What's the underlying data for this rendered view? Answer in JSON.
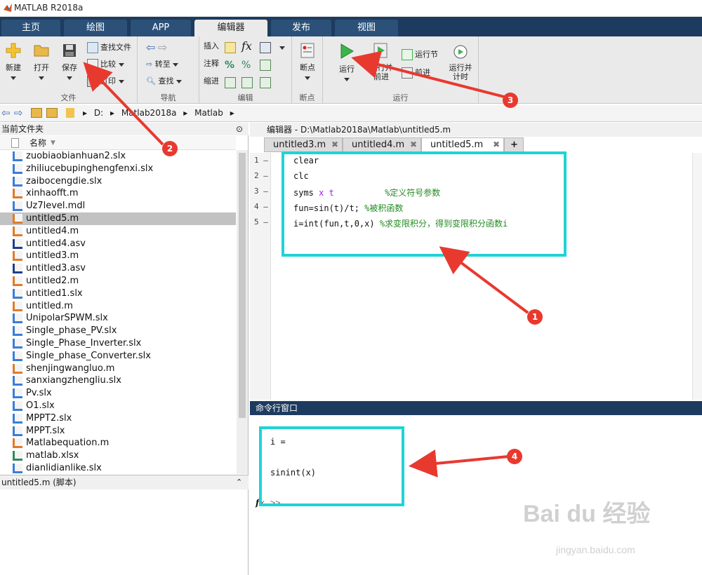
{
  "app": {
    "title": "MATLAB R2018a"
  },
  "tabs": [
    "主页",
    "绘图",
    "APP",
    "编辑器",
    "发布",
    "视图"
  ],
  "ribbon": {
    "file_group": {
      "label": "文件",
      "new": "新建",
      "open": "打开",
      "save": "保存",
      "find_files": "查找文件",
      "compare": "比较",
      "print": "打印"
    },
    "nav_group": {
      "label": "导航",
      "goto": "转至",
      "find": "查找"
    },
    "edit_group": {
      "label": "编辑",
      "insert": "插入",
      "comment": "注释",
      "indent": "缩进"
    },
    "breakpoints_group": {
      "label": "断点",
      "breakpoints": "断点"
    },
    "run_group": {
      "label": "运行",
      "run": "运行",
      "run_advance": "运行并前进",
      "run_section": "运行节",
      "advance": "前进",
      "run_time": "运行并计时"
    }
  },
  "address": {
    "segments": [
      "D:",
      "Matlab2018a",
      "Matlab"
    ]
  },
  "file_browser": {
    "title": "当前文件夹",
    "column": "名称",
    "files": [
      {
        "name": "zuobiaobianhuan2.slx",
        "kind": "slx"
      },
      {
        "name": "zhiliucebupinghengfenxi.slx",
        "kind": "slx"
      },
      {
        "name": "zaibocengdie.slx",
        "kind": "slx"
      },
      {
        "name": "xinhaofft.m",
        "kind": "m"
      },
      {
        "name": "Uz7level.mdl",
        "kind": "mdl"
      },
      {
        "name": "untitled5.m",
        "kind": "m"
      },
      {
        "name": "untitled4.m",
        "kind": "m"
      },
      {
        "name": "untitled4.asv",
        "kind": "asv"
      },
      {
        "name": "untitled3.m",
        "kind": "m"
      },
      {
        "name": "untitled3.asv",
        "kind": "asv"
      },
      {
        "name": "untitled2.m",
        "kind": "m"
      },
      {
        "name": "untitled1.slx",
        "kind": "slx"
      },
      {
        "name": "untitled.m",
        "kind": "m"
      },
      {
        "name": "UnipolarSPWM.slx",
        "kind": "slx"
      },
      {
        "name": "Single_phase_PV.slx",
        "kind": "slx"
      },
      {
        "name": "Single_Phase_Inverter.slx",
        "kind": "slx"
      },
      {
        "name": "Single_phase_Converter.slx",
        "kind": "slx"
      },
      {
        "name": "shenjingwangluo.m",
        "kind": "m"
      },
      {
        "name": "sanxiangzhengliu.slx",
        "kind": "slx"
      },
      {
        "name": "Pv.slx",
        "kind": "slx"
      },
      {
        "name": "O1.slx",
        "kind": "slx"
      },
      {
        "name": "MPPT2.slx",
        "kind": "slx"
      },
      {
        "name": "MPPT.slx",
        "kind": "slx"
      },
      {
        "name": "Matlabequation.m",
        "kind": "m"
      },
      {
        "name": "matlab.xlsx",
        "kind": "xlsx"
      },
      {
        "name": "dianlidianlike.slx",
        "kind": "slx"
      }
    ],
    "selected": "untitled5.m"
  },
  "details": {
    "title": "untitled5.m (脚本)"
  },
  "editor": {
    "title": "编辑器 - D:\\Matlab2018a\\Matlab\\untitled5.m",
    "tabs": [
      "untitled3.m",
      "untitled4.m",
      "untitled5.m"
    ],
    "add_tab": "+",
    "lines": [
      {
        "num": "1",
        "dash": "—",
        "code": "clear"
      },
      {
        "num": "2",
        "dash": "—",
        "code": "clc"
      },
      {
        "num": "3",
        "dash": "—",
        "pre": "syms ",
        "vars": "x t",
        "comment": "%定义符号参数"
      },
      {
        "num": "4",
        "dash": "—",
        "pre": "fun=sin(t)/t; ",
        "comment": "%被积函数"
      },
      {
        "num": "5",
        "dash": "—",
        "pre": "i=int(fun,t,0,x) ",
        "comment": "%求变限积分，得到变限积分函数i"
      }
    ]
  },
  "command_window": {
    "title": "命令行窗口",
    "output": [
      "i =",
      "sinint(x)",
      ">>"
    ],
    "fx": "fx"
  },
  "annotations": [
    "1",
    "2",
    "3",
    "4"
  ],
  "watermark": {
    "brand": "Bai du 经验",
    "url": "jingyan.baidu.com"
  },
  "colors": {
    "accent_cyan": "#1fd3d6",
    "arrow_red": "#e8392f",
    "tab_bar": "#1d3b5e"
  }
}
